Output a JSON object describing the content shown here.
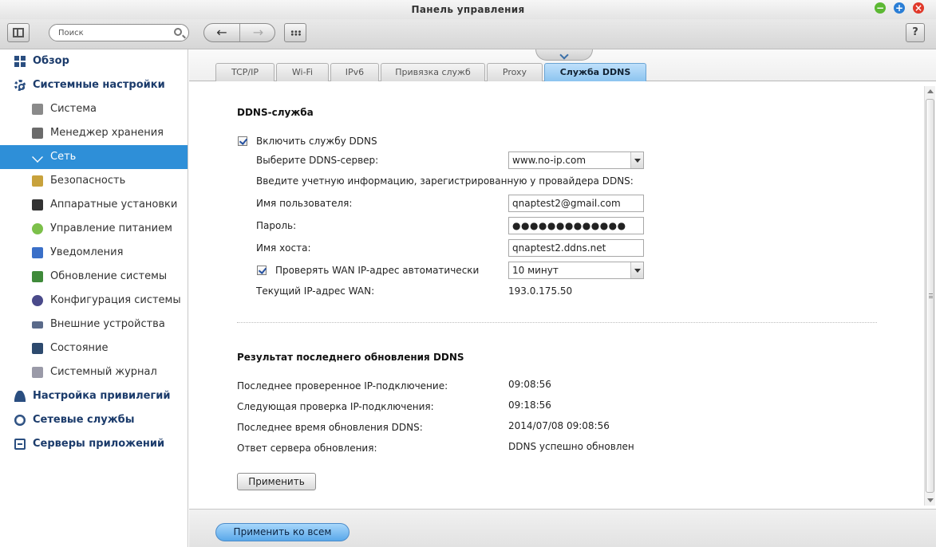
{
  "window": {
    "title": "Панель управления",
    "controls": {
      "minimize": "−",
      "maximize": "+",
      "close": "×"
    }
  },
  "toolbar": {
    "search_placeholder": "Поиск",
    "back": "←",
    "forward": "→",
    "help": "?"
  },
  "sidebar": {
    "items": [
      {
        "label": "Обзор",
        "level": "top",
        "icon": "overview-grid-icon"
      },
      {
        "label": "Системные настройки",
        "level": "top",
        "icon": "gear-icon"
      },
      {
        "label": "Система",
        "level": "sub",
        "icon": "system-icon",
        "color": "#8a8a8a"
      },
      {
        "label": "Менеджер хранения",
        "level": "sub",
        "icon": "storage-icon",
        "color": "#6b6b6b"
      },
      {
        "label": "Сеть",
        "level": "sub",
        "icon": "network-icon",
        "color": "#ffffff",
        "active": true
      },
      {
        "label": "Безопасность",
        "level": "sub",
        "icon": "lock-icon",
        "color": "#c8a23c"
      },
      {
        "label": "Аппаратные установки",
        "level": "sub",
        "icon": "hardware-icon",
        "color": "#333333"
      },
      {
        "label": "Управление питанием",
        "level": "sub",
        "icon": "power-bulb-icon",
        "color": "#7cc04a"
      },
      {
        "label": "Уведомления",
        "level": "sub",
        "icon": "notification-icon",
        "color": "#3a6fc8"
      },
      {
        "label": "Обновление системы",
        "level": "sub",
        "icon": "firmware-update-icon",
        "color": "#3f8a3a"
      },
      {
        "label": "Конфигурация системы",
        "level": "sub",
        "icon": "config-icon",
        "color": "#4a4a8a"
      },
      {
        "label": "Внешние устройства",
        "level": "sub",
        "icon": "external-device-icon",
        "color": "#5a6a8a"
      },
      {
        "label": "Состояние",
        "level": "sub",
        "icon": "status-monitor-icon",
        "color": "#2d4a6e"
      },
      {
        "label": "Системный журнал",
        "level": "sub",
        "icon": "system-log-icon",
        "color": "#9a9aa8"
      },
      {
        "label": "Настройка привилегий",
        "level": "top",
        "icon": "user-icon"
      },
      {
        "label": "Сетевые службы",
        "level": "top",
        "icon": "globe-icon"
      },
      {
        "label": "Серверы приложений",
        "level": "top",
        "icon": "server-icon"
      }
    ]
  },
  "tabs": [
    {
      "label": "TCP/IP"
    },
    {
      "label": "Wi-Fi"
    },
    {
      "label": "IPv6"
    },
    {
      "label": "Привязка служб"
    },
    {
      "label": "Proxy"
    },
    {
      "label": "Служба DDNS",
      "active": true
    }
  ],
  "ddns": {
    "section_title": "DDNS-служба",
    "enable_label": "Включить службу DDNS",
    "enable_checked": true,
    "server_label": "Выберите DDNS-сервер:",
    "server_value": "www.no-ip.com",
    "info_text": "Введите учетную информацию, зарегистрированную у провайдера DDNS:",
    "username_label": "Имя пользователя:",
    "username_value": "qnaptest2@gmail.com",
    "password_label": "Пароль:",
    "password_value": "●●●●●●●●●●●●●",
    "hostname_label": "Имя хоста:",
    "hostname_value": "qnaptest2.ddns.net",
    "wan_check_label": "Проверять WAN IP-адрес автоматически",
    "wan_check_checked": true,
    "wan_interval": "10 минут",
    "current_ip_label": "Текущий IP-адрес WAN:",
    "current_ip_value": "193.0.175.50"
  },
  "result": {
    "section_title": "Результат последнего обновления DDNS",
    "rows": [
      {
        "label": "Последнее проверенное IP-подключение:",
        "value": "09:08:56"
      },
      {
        "label": "Следующая проверка IP-подключения:",
        "value": "09:18:56"
      },
      {
        "label": "Последнее время обновления DDNS:",
        "value": "2014/07/08 09:08:56"
      },
      {
        "label": "Ответ сервера обновления:",
        "value": "DDNS успешно обновлен"
      }
    ]
  },
  "buttons": {
    "apply": "Применить",
    "apply_all": "Применить ко всем"
  },
  "colors": {
    "accent": "#2e8fd8",
    "sidebar_heading": "#1b3b6b",
    "active_tab": "#8cc4ef"
  }
}
